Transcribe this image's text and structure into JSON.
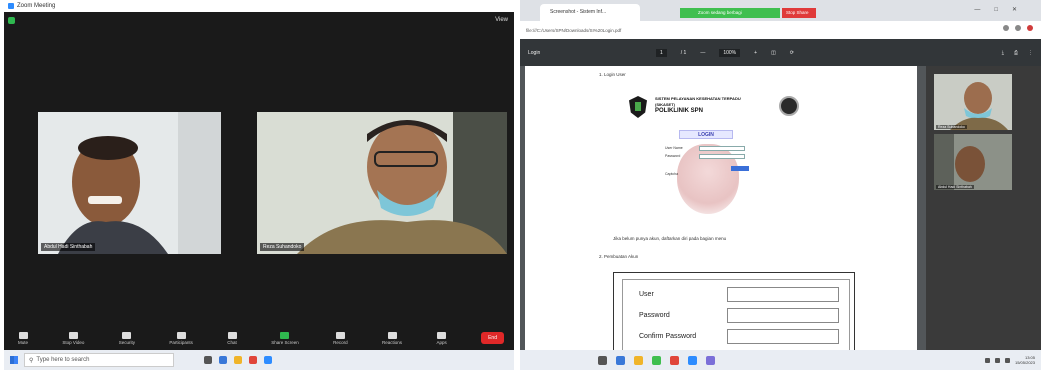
{
  "zoom": {
    "window_title": "Zoom Meeting",
    "view_label": "View",
    "participants": [
      {
        "name": "Abdul Hadi Sinthabah"
      },
      {
        "name": "Reza Suhandoko"
      }
    ],
    "controls": [
      {
        "label": "Mute",
        "icon": "microphone-icon"
      },
      {
        "label": "Stop Video",
        "icon": "camera-icon"
      },
      {
        "label": "Security",
        "icon": "shield-icon"
      },
      {
        "label": "Participants",
        "icon": "people-icon"
      },
      {
        "label": "Chat",
        "icon": "chat-icon"
      },
      {
        "label": "Share Screen",
        "icon": "share-screen-icon"
      },
      {
        "label": "Record",
        "icon": "record-icon"
      },
      {
        "label": "Reactions",
        "icon": "reactions-icon"
      },
      {
        "label": "Apps",
        "icon": "apps-icon"
      }
    ],
    "end_label": "End"
  },
  "taskbar_left": {
    "search_placeholder": "Type here to search"
  },
  "browser": {
    "tab_title": "Screenshot - Sistem Inf...",
    "green_banner": "Zoom sedang berbagi",
    "red_banner": "Stop Share",
    "address": "file:///C:/Users/SPN/Downloads/SI%20Login.pdf",
    "pdf_title": "Login",
    "page_current": "1",
    "page_total": "/ 1",
    "zoom_level": "100%",
    "sections": {
      "login_heading": "1.   Login User",
      "logo_line1": "SISTEM PELAYANAN KESEHATAN TERPADU",
      "logo_line2": "(SIKASET)",
      "logo_line3": "POLIKLINIK SPN",
      "login_title": "LOGIN",
      "login_user_label": "User Name",
      "login_pass_label": "Password",
      "login_captcha_label": "Captcha",
      "note": "Jika belum punya akun, daftarkan diri pada bagian menu",
      "register_heading": "2.   Pembuatan Akun"
    },
    "form": {
      "user_label": "User",
      "password_label": "Password",
      "confirm_label": "Confirm Password"
    },
    "side_videos": [
      {
        "name": "Reza Suhandoko"
      },
      {
        "name": "Abdul Hadi Sinthabah"
      }
    ],
    "tray_time": "13:05",
    "tray_date": "15/05/2023"
  }
}
